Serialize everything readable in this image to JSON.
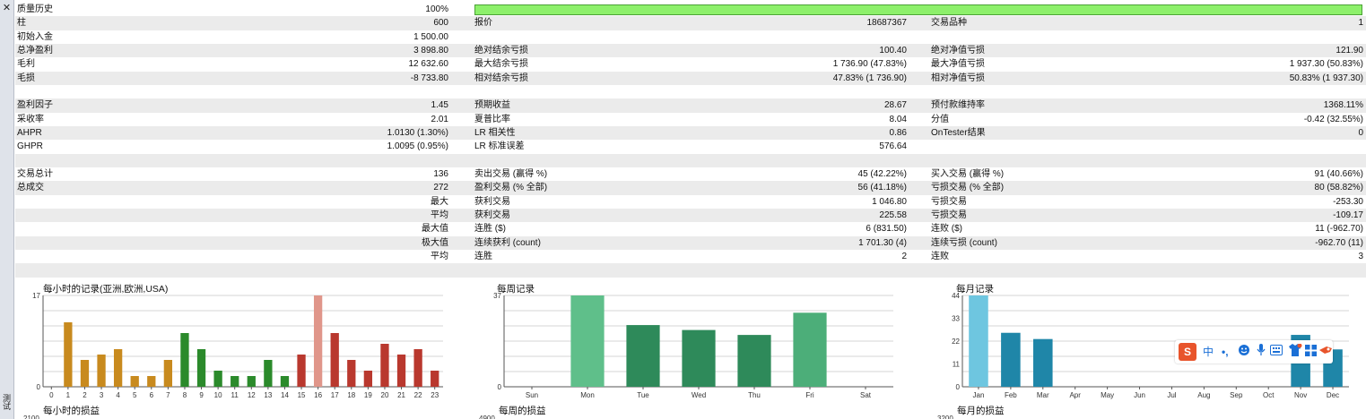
{
  "window": {
    "close_glyph": "✕",
    "side_label": "测试"
  },
  "quality": {
    "label": "质量历史",
    "value": "100%"
  },
  "rows": [
    {
      "shade": true,
      "l1": "柱",
      "v1": "600",
      "l2": "报价",
      "v2": "18687367",
      "l3": "交易品种",
      "v3": "1"
    },
    {
      "shade": false,
      "l1": "初始入金",
      "v1": "1 500.00",
      "l2": "",
      "v2": "",
      "l3": "",
      "v3": ""
    },
    {
      "shade": true,
      "l1": "总净盈利",
      "v1": "3 898.80",
      "l2": "绝对结余亏损",
      "v2": "100.40",
      "l3": "绝对净值亏损",
      "v3": "121.90"
    },
    {
      "shade": false,
      "l1": "毛利",
      "v1": "12 632.60",
      "l2": "最大结余亏损",
      "v2": "1 736.90 (47.83%)",
      "l3": "最大净值亏损",
      "v3": "1 937.30 (50.83%)"
    },
    {
      "shade": true,
      "l1": "毛损",
      "v1": "-8 733.80",
      "l2": "相对结余亏损",
      "v2": "47.83% (1 736.90)",
      "l3": "相对净值亏损",
      "v3": "50.83% (1 937.30)"
    },
    {
      "shade": false,
      "l1": "",
      "v1": "",
      "l2": "",
      "v2": "",
      "l3": "",
      "v3": ""
    },
    {
      "shade": true,
      "l1": "盈利因子",
      "v1": "1.45",
      "l2": "预期收益",
      "v2": "28.67",
      "l3": "预付款维持率",
      "v3": "1368.11%"
    },
    {
      "shade": false,
      "l1": "采收率",
      "v1": "2.01",
      "l2": "夏普比率",
      "v2": "8.04",
      "l3": "分值",
      "v3": "-0.42 (32.55%)"
    },
    {
      "shade": true,
      "l1": "AHPR",
      "v1": "1.0130 (1.30%)",
      "l2": "LR 相关性",
      "v2": "0.86",
      "l3": "OnTester结果",
      "v3": "0"
    },
    {
      "shade": false,
      "l1": "GHPR",
      "v1": "1.0095 (0.95%)",
      "l2": "LR 标准误差",
      "v2": "576.64",
      "l3": "",
      "v3": ""
    },
    {
      "shade": true,
      "l1": "",
      "v1": "",
      "l2": "",
      "v2": "",
      "l3": "",
      "v3": ""
    },
    {
      "shade": false,
      "l1": "交易总计",
      "v1": "136",
      "l2": "卖出交易 (赢得 %)",
      "v2": "45 (42.22%)",
      "l3": "买入交易 (赢得 %)",
      "v3": "91 (40.66%)"
    },
    {
      "shade": true,
      "l1": "总成交",
      "v1": "272",
      "l2": "盈利交易 (% 全部)",
      "v2": "56 (41.18%)",
      "l3": "亏损交易 (% 全部)",
      "v3": "80 (58.82%)"
    },
    {
      "shade": false,
      "l1": "",
      "v1": "最大",
      "l2": "获利交易",
      "v2": "1 046.80",
      "l3": "亏损交易",
      "v3": "-253.30"
    },
    {
      "shade": true,
      "l1": "",
      "v1": "平均",
      "l2": "获利交易",
      "v2": "225.58",
      "l3": "亏损交易",
      "v3": "-109.17"
    },
    {
      "shade": false,
      "l1": "",
      "v1": "最大值",
      "l2": "连胜 ($)",
      "v2": "6 (831.50)",
      "l3": "连败 ($)",
      "v3": "11 (-962.70)"
    },
    {
      "shade": true,
      "l1": "",
      "v1": "极大值",
      "l2": "连续获利 (count)",
      "v2": "1 701.30 (4)",
      "l3": "连续亏损 (count)",
      "v3": "-962.70 (11)"
    },
    {
      "shade": false,
      "l1": "",
      "v1": "平均",
      "l2": "连胜",
      "v2": "2",
      "l3": "连败",
      "v3": "3"
    },
    {
      "shade": true,
      "l1": "",
      "v1": "",
      "l2": "",
      "v2": "",
      "l3": "",
      "v3": ""
    }
  ],
  "chart_data": [
    {
      "type": "bar",
      "title": "每小时的记录(亚洲,欧洲,USA)",
      "categories": [
        "0",
        "1",
        "2",
        "3",
        "4",
        "5",
        "6",
        "7",
        "8",
        "9",
        "10",
        "11",
        "12",
        "13",
        "14",
        "15",
        "16",
        "17",
        "18",
        "19",
        "20",
        "21",
        "22",
        "23"
      ],
      "values": [
        0,
        12,
        5,
        6,
        7,
        2,
        2,
        5,
        10,
        7,
        3,
        2,
        2,
        5,
        2,
        6,
        17,
        10,
        5,
        3,
        8,
        6,
        7,
        3
      ],
      "colors": [
        "#c88a1e",
        "#c88a1e",
        "#c88a1e",
        "#c88a1e",
        "#c88a1e",
        "#c88a1e",
        "#c88a1e",
        "#c88a1e",
        "#2b8a2b",
        "#2b8a2b",
        "#2b8a2b",
        "#2b8a2b",
        "#2b8a2b",
        "#2b8a2b",
        "#2b8a2b",
        "#b9382e",
        "#e0968a",
        "#b9382e",
        "#b9382e",
        "#b9382e",
        "#b9382e",
        "#b9382e",
        "#b9382e",
        "#b9382e"
      ],
      "yticks": [
        "0",
        "17"
      ],
      "ylim": [
        0,
        17
      ],
      "grid": true
    },
    {
      "type": "bar",
      "title": "每周记录",
      "categories": [
        "Sun",
        "Mon",
        "Tue",
        "Wed",
        "Thu",
        "Fri",
        "Sat"
      ],
      "values": [
        0,
        37,
        25,
        23,
        21,
        30,
        0
      ],
      "colors": [
        "#2e8a5a",
        "#5fbf8a",
        "#2e8a5a",
        "#2e8a5a",
        "#2e8a5a",
        "#4cae79",
        "#2e8a5a"
      ],
      "yticks": [
        "0",
        "37"
      ],
      "ylim": [
        0,
        37
      ],
      "grid": true
    },
    {
      "type": "bar",
      "title": "每月记录",
      "categories": [
        "Jan",
        "Feb",
        "Mar",
        "Apr",
        "May",
        "Jun",
        "Jul",
        "Aug",
        "Sep",
        "Oct",
        "Nov",
        "Dec"
      ],
      "values": [
        44,
        26,
        23,
        0,
        0,
        0,
        0,
        0,
        0,
        0,
        25,
        18
      ],
      "colors": [
        "#6ec6e0",
        "#1f86a8",
        "#1f86a8",
        "#1f86a8",
        "#1f86a8",
        "#1f86a8",
        "#1f86a8",
        "#1f86a8",
        "#1f86a8",
        "#1f86a8",
        "#1f86a8",
        "#1f86a8"
      ],
      "yticks": [
        "0",
        "11",
        "22",
        "33",
        "44"
      ],
      "ylim": [
        0,
        44
      ],
      "grid": true
    }
  ],
  "bottom_charts": [
    {
      "title": "每小时的损益",
      "top_tick": "2100"
    },
    {
      "title": "每周的损益",
      "top_tick": "4900"
    },
    {
      "title": "每月的损益",
      "top_tick": "3200"
    }
  ],
  "ime": {
    "brand": "S",
    "lang": "中",
    "punct": "•,",
    "emoji_icon": "smile-icon",
    "mic_icon": "mic-icon",
    "keyboard_icon": "keyboard-icon",
    "skin_icon": "shirt-icon",
    "apps_icon": "grid-icon",
    "tool_icon": "tool-icon"
  }
}
